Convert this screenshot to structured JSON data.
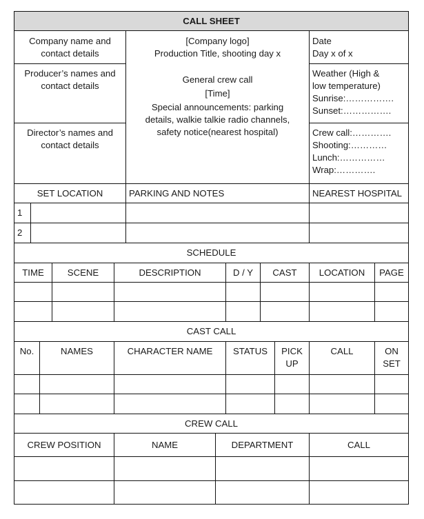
{
  "title": "CALL SHEET",
  "header_block": {
    "company": [
      "Company name and",
      "contact details"
    ],
    "producer": [
      "Producer’s names and",
      "contact details"
    ],
    "director": [
      "Director’s names and",
      "contact details"
    ],
    "center": {
      "logo": "[Company logo]",
      "production": "Production Title, shooting day x",
      "general_crew_call": "General crew call",
      "time": "[Time]",
      "announcements": [
        "Special announcements: parking",
        "details, walkie talkie radio channels,",
        "safety notice(nearest hospital)"
      ]
    },
    "date": [
      "Date",
      "Day x of x"
    ],
    "weather": [
      "Weather (High &",
      "low temperature)",
      "Sunrise:…………….",
      "Sunset:……………."
    ],
    "times": [
      "Crew call:………….",
      "Shooting:…………",
      "Lunch:……………",
      "Wrap:…………."
    ]
  },
  "location": {
    "headers": [
      "SET LOCATION",
      "PARKING AND NOTES",
      "NEAREST HOSPITAL"
    ],
    "rows": [
      {
        "num": "1",
        "set_location": "",
        "parking": "",
        "hospital": ""
      },
      {
        "num": "2",
        "set_location": "",
        "parking": "",
        "hospital": ""
      }
    ]
  },
  "schedule": {
    "title": "SCHEDULE",
    "headers": [
      "TIME",
      "SCENE",
      "DESCRIPTION",
      "D / Y",
      "CAST",
      "LOCATION",
      "PAGE"
    ],
    "rows": [
      [
        "",
        "",
        "",
        "",
        "",
        "",
        ""
      ],
      [
        "",
        "",
        "",
        "",
        "",
        "",
        ""
      ]
    ]
  },
  "cast_call": {
    "title": "CAST CALL",
    "headers": [
      "No.",
      "NAMES",
      "CHARACTER NAME",
      "STATUS",
      [
        "PICK",
        "UP"
      ],
      "CALL",
      [
        "ON",
        "SET"
      ]
    ],
    "rows": [
      [
        "",
        "",
        "",
        "",
        "",
        "",
        ""
      ],
      [
        "",
        "",
        "",
        "",
        "",
        "",
        ""
      ]
    ]
  },
  "crew_call": {
    "title": "CREW CALL",
    "headers": [
      "CREW POSITION",
      "NAME",
      "DEPARTMENT",
      "CALL"
    ],
    "rows": [
      [
        "",
        "",
        "",
        ""
      ],
      [
        "",
        "",
        "",
        ""
      ]
    ]
  },
  "colors": {
    "title_bg": "#d9d9d9",
    "border": "#111111"
  }
}
